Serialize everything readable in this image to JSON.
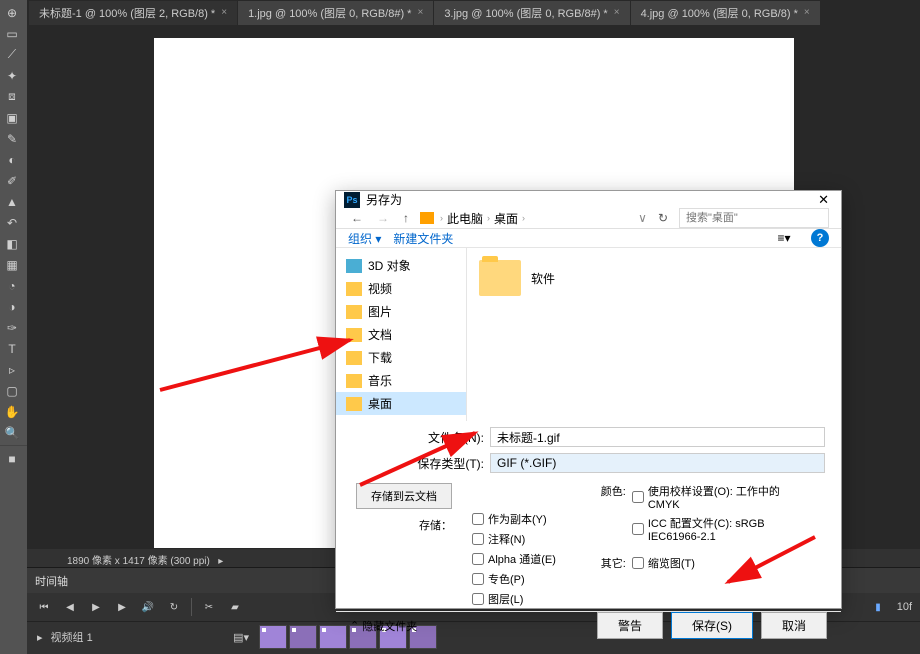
{
  "tabs": [
    {
      "label": "未标题-1 @ 100% (图层 2, RGB/8) *",
      "active": true
    },
    {
      "label": "1.jpg @ 100% (图层 0, RGB/8#) *",
      "active": false
    },
    {
      "label": "3.jpg @ 100% (图层 0, RGB/8#) *",
      "active": false
    },
    {
      "label": "4.jpg @ 100% (图层 0, RGB/8) *",
      "active": false
    }
  ],
  "statusbar": "1890 像素 x 1417 像素 (300 ppi)",
  "timeline": {
    "title": "时间轴",
    "fps": "10f",
    "track": "视频组 1"
  },
  "dialog": {
    "title": "另存为",
    "breadcrumb": [
      "此电脑",
      "桌面"
    ],
    "searchPlaceholder": "搜索\"桌面\"",
    "toolbar": {
      "organize": "组织",
      "newFolder": "新建文件夹"
    },
    "sidebar": [
      {
        "label": "3D 对象",
        "type": "obj"
      },
      {
        "label": "视频",
        "type": "folder"
      },
      {
        "label": "图片",
        "type": "folder"
      },
      {
        "label": "文档",
        "type": "folder"
      },
      {
        "label": "下载",
        "type": "folder"
      },
      {
        "label": "音乐",
        "type": "folder"
      },
      {
        "label": "桌面",
        "type": "folder",
        "selected": true
      }
    ],
    "filearea": {
      "folder": "软件"
    },
    "fields": {
      "nameLabel": "文件名(N):",
      "nameValue": "未标题-1.gif",
      "typeLabel": "保存类型(T):",
      "typeValue": "GIF (*.GIF)"
    },
    "options": {
      "cloudBtn": "存储到云文档",
      "saveLabel": "存储：",
      "saveCopy": "作为副本(Y)",
      "notes": "注释(N)",
      "alpha": "Alpha 通道(E)",
      "spot": "专色(P)",
      "layers": "图层(L)",
      "colorLabel": "颜色:",
      "colorProof": "使用校样设置(O): 工作中的 CMYK",
      "icc": "ICC 配置文件(C): sRGB IEC61966-2.1",
      "otherLabel": "其它:",
      "thumb": "缩览图(T)"
    },
    "footer": {
      "hideFolders": "隐藏文件夹",
      "warn": "警告",
      "save": "保存(S)",
      "cancel": "取消"
    }
  }
}
